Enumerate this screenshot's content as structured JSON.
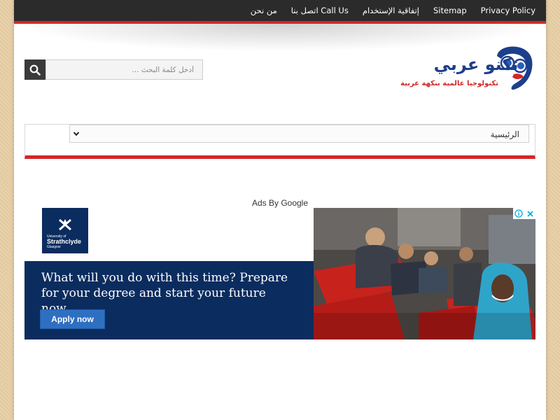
{
  "topbar": {
    "links": [
      "Privacy Policy",
      "Sitemap",
      "إتفاقية الإستخدام",
      "اتصل بنا Call Us",
      "من نحن"
    ]
  },
  "search": {
    "placeholder": "أدخل كلمة البحث ..."
  },
  "logo": {
    "title": "تكنو عربي",
    "tagline": "تكنولوجيا عالمية بنكهة عربية"
  },
  "nav": {
    "selected": "الرئيسية"
  },
  "ads": {
    "label": "Ads By Google",
    "brand_small": "University of",
    "brand_name": "Strathclyde",
    "brand_city": "Glasgow",
    "headline": "What will you do with this time? Prepare for your degree and start your future now",
    "cta": "Apply now"
  },
  "colors": {
    "accent": "#d32727",
    "topbar": "#2b2b2b",
    "ad_bg": "#0b2c5f",
    "ad_button": "#2e6fc1"
  }
}
